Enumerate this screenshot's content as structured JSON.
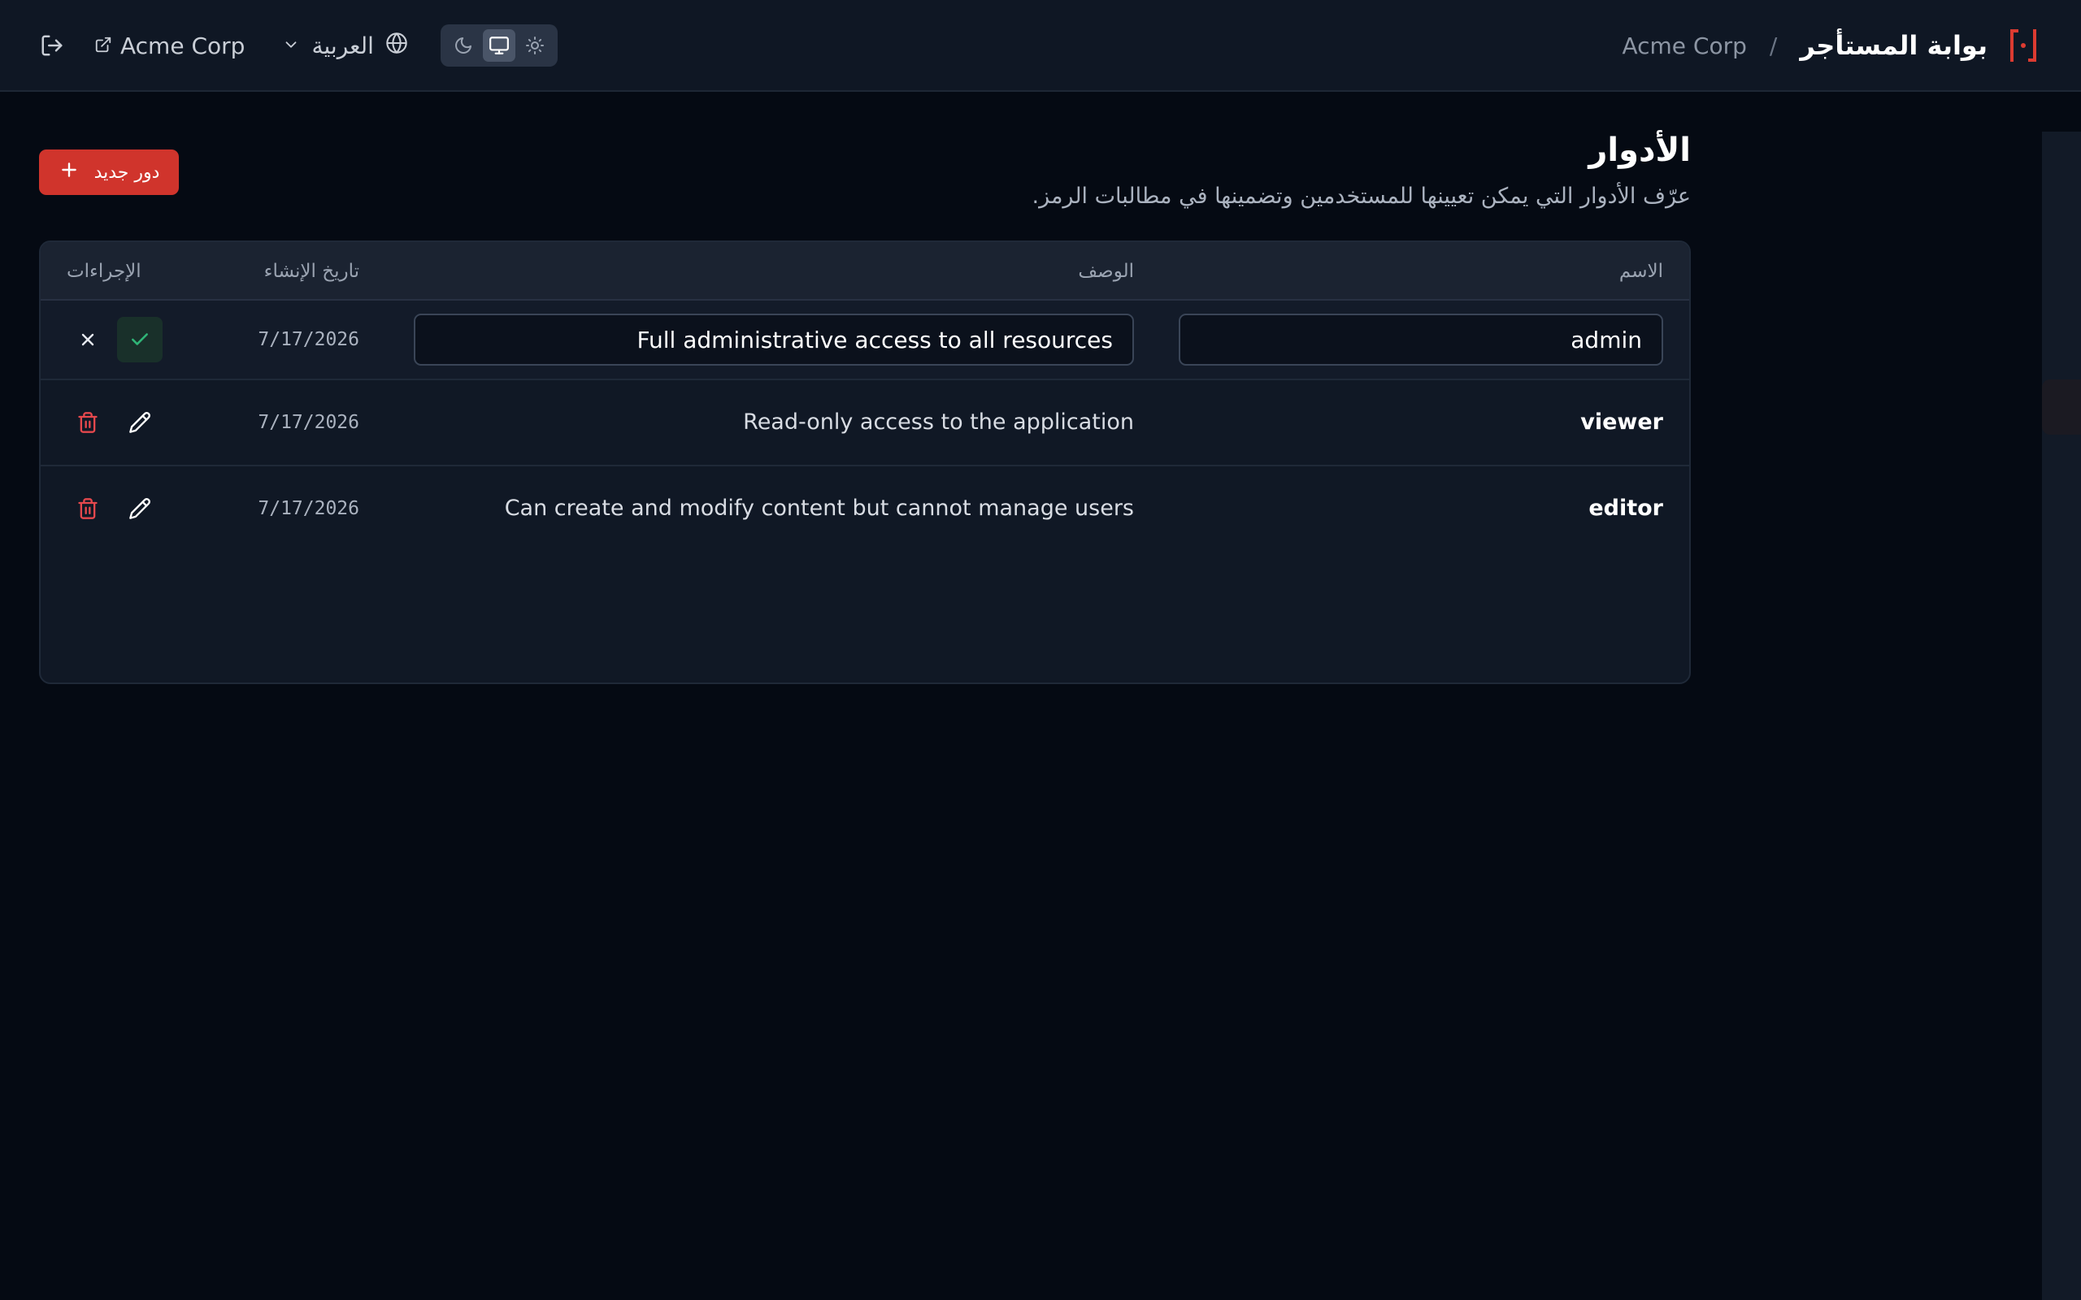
{
  "header": {
    "app_title": "بوابة المستأجر",
    "separator": "/",
    "tenant_name": "Acme Corp",
    "tenant_link_label": "Acme Corp",
    "language": "العربية",
    "theme_modes": [
      "dark",
      "system",
      "light"
    ],
    "active_theme": "system"
  },
  "page": {
    "title": "الأدوار",
    "subtitle": "عرّف الأدوار التي يمكن تعيينها للمستخدمين وتضمينها في مطالبات الرمز.",
    "new_button_label": "دور جديد"
  },
  "table": {
    "columns": {
      "name": "الاسم",
      "description": "الوصف",
      "created": "تاريخ الإنشاء",
      "actions": "الإجراءات"
    },
    "editing_row": {
      "name": "admin",
      "description": "Full administrative access to all resources",
      "created": "7/17/2026"
    },
    "rows": [
      {
        "name": "viewer",
        "description": "Read-only access to the application",
        "created": "7/17/2026"
      },
      {
        "name": "editor",
        "description": "Can create and modify content but cannot manage users",
        "created": "7/17/2026"
      }
    ]
  },
  "colors": {
    "accent": "#d0342c",
    "background": "#050a13",
    "header": "#0f1724",
    "success": "#2fb577",
    "danger": "#e5484d"
  }
}
